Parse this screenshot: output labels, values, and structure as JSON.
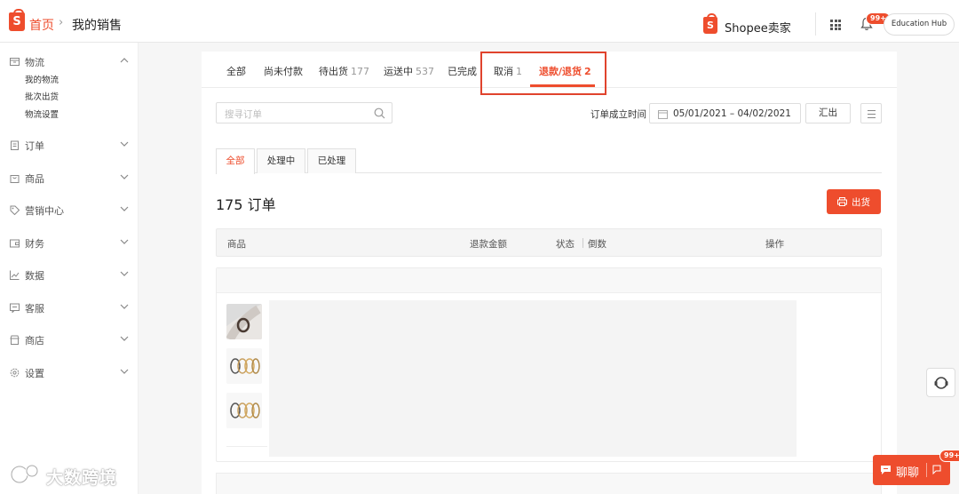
{
  "breadcrumb": {
    "home": "首页",
    "separator": "›",
    "current": "我的销售"
  },
  "header": {
    "brand": "Shopee卖家",
    "notification_badge": "99+",
    "education_hub": "Education Hub"
  },
  "sidebar": {
    "sections": [
      {
        "label": "物流",
        "icon": "box-icon",
        "expanded": true,
        "items": [
          "我的物流",
          "批次出货",
          "物流设置"
        ]
      },
      {
        "label": "订单",
        "icon": "clipboard-icon",
        "expanded": false
      },
      {
        "label": "商品",
        "icon": "bag-icon",
        "expanded": false
      },
      {
        "label": "营销中心",
        "icon": "tag-icon",
        "expanded": false
      },
      {
        "label": "财务",
        "icon": "wallet-icon",
        "expanded": false
      },
      {
        "label": "数据",
        "icon": "chart-icon",
        "expanded": false
      },
      {
        "label": "客服",
        "icon": "chat-bubble-icon",
        "expanded": false
      },
      {
        "label": "商店",
        "icon": "store-icon",
        "expanded": false
      },
      {
        "label": "设置",
        "icon": "gear-icon",
        "expanded": false
      }
    ]
  },
  "tabs": [
    {
      "label": "全部",
      "count": ""
    },
    {
      "label": "尚未付款",
      "count": ""
    },
    {
      "label": "待出货",
      "count": "177"
    },
    {
      "label": "运送中",
      "count": "537"
    },
    {
      "label": "已完成",
      "count": ""
    },
    {
      "label": "取消",
      "count": "1"
    },
    {
      "label": "退款/退货",
      "count": "2",
      "active": true
    }
  ],
  "search": {
    "placeholder": "搜寻订单"
  },
  "date_filter": {
    "label": "订单成立时间",
    "range": "05/01/2021 – 04/02/2021"
  },
  "export_label": "汇出",
  "subtabs": [
    {
      "label": "全部",
      "active": true
    },
    {
      "label": "处理中",
      "active": false
    },
    {
      "label": "已处理",
      "active": false
    }
  ],
  "order_count": "175 订单",
  "ship_button": "出货",
  "table_headers": {
    "product": "商品",
    "refund_amount": "退款金额",
    "status": "状态",
    "countdown": "倒数",
    "action": "操作"
  },
  "chat": {
    "label": "聊聊",
    "badge": "99+"
  },
  "watermark": "大数跨境",
  "colors": {
    "accent": "#ee4d2d",
    "highlight_box": "#e0432d"
  }
}
